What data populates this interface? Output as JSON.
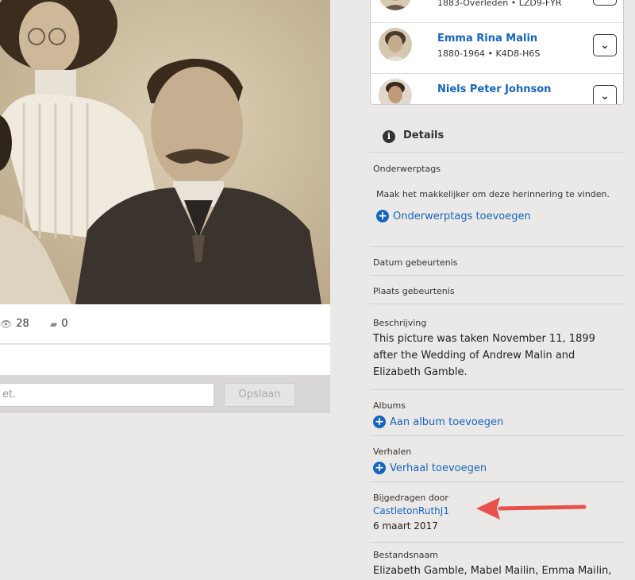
{
  "photo": {
    "alt": ""
  },
  "stats": {
    "views": "28",
    "comments": "0"
  },
  "comment": {
    "placeholder": "et.",
    "save_label": "Opslaan"
  },
  "persons": [
    {
      "name": "",
      "meta": "1883-Overleden • LZD9-FYR"
    },
    {
      "name": "Emma Rina Malin",
      "meta": "1880-1964 • K4D8-H6S"
    },
    {
      "name": "Niels Peter Johnson",
      "meta": ""
    }
  ],
  "details": {
    "title": "Details",
    "subject_tags": {
      "label": "Onderwerptags",
      "hint": "Maak het makkelijker om deze herinnering te vinden.",
      "add_label": "Onderwerptags toevoegen"
    },
    "event_date_label": "Datum gebeurtenis",
    "event_place_label": "Plaats gebeurtenis",
    "description": {
      "label": "Beschrijving",
      "line1": "This picture was taken November 11, 1899",
      "line2": "after the Wedding of Andrew Malin and",
      "line3": "Elizabeth Gamble."
    },
    "albums": {
      "label": "Albums",
      "add_label": "Aan album toevoegen"
    },
    "stories": {
      "label": "Verhalen",
      "add_label": "Verhaal toevoegen"
    },
    "contributed": {
      "label": "Bijgedragen door",
      "user": "CastletonRuthJ1",
      "date": "6 maart 2017"
    },
    "filename": {
      "label": "Bestandsnaam",
      "value": "Elizabeth Gamble, Mabel Mailin, Emma Mailin,"
    }
  },
  "colors": {
    "link": "#1565c0",
    "arrow": "#e8524a",
    "background": "#ebe9e7"
  },
  "icons": {
    "views": "eye-icon",
    "comments": "comment-icon",
    "info": "info-icon",
    "add": "plus-circle-icon",
    "expand": "chevron-down-icon"
  }
}
